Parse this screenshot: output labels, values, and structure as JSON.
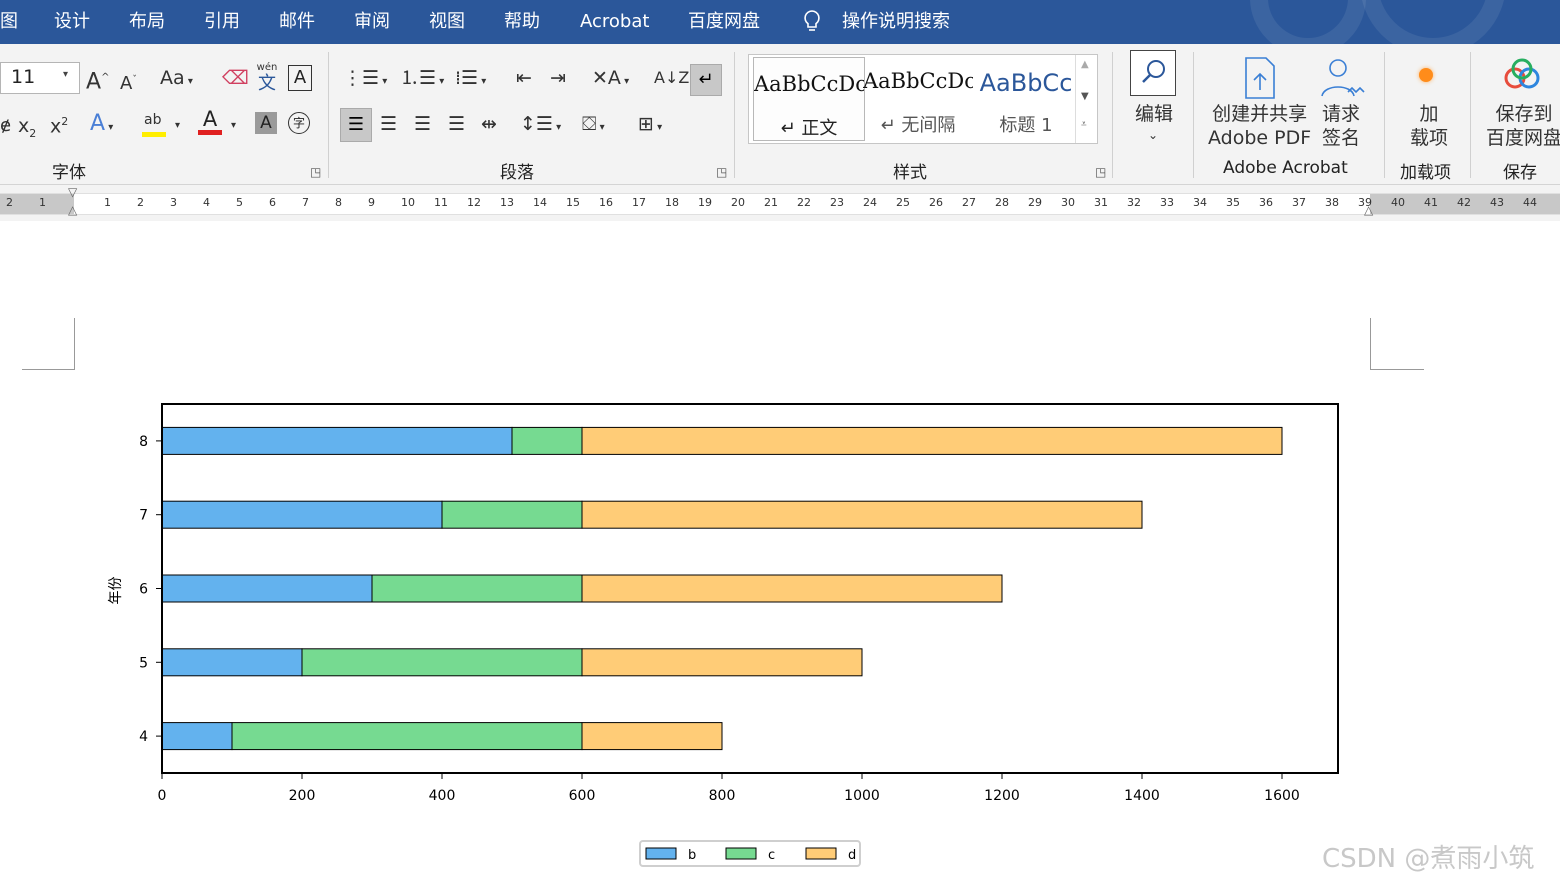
{
  "menu": {
    "items": [
      "图",
      "设计",
      "布局",
      "引用",
      "邮件",
      "审阅",
      "视图",
      "帮助",
      "Acrobat",
      "百度网盘"
    ],
    "search_label": "操作说明搜索"
  },
  "ribbon": {
    "font": {
      "size_value": "11",
      "aa_label": "Aa",
      "wen_label": "wén",
      "wen_char": "文",
      "group_label": "字体"
    },
    "paragraph": {
      "group_label": "段落"
    },
    "styles": {
      "items": [
        {
          "preview": "AaBbCcDc",
          "name": "↵ 正文"
        },
        {
          "preview": "AaBbCcDc",
          "name": "↵ 无间隔"
        },
        {
          "preview": "AaBbCc",
          "name": "标题 1"
        }
      ],
      "group_label": "样式"
    },
    "edit": {
      "label": "编辑"
    },
    "acrobat": {
      "create_line1": "创建并共享",
      "create_line2": "Adobe PDF",
      "sign_line1": "请求",
      "sign_line2": "签名",
      "group_label": "Adobe Acrobat"
    },
    "addins": {
      "line1": "加",
      "line2": "载项",
      "group_label": "加载项"
    },
    "baidu": {
      "line1": "保存到",
      "line2": "百度网盘",
      "group_label": "保存"
    }
  },
  "ruler": {
    "left_numbers": [
      "2",
      "1"
    ],
    "numbers": [
      "1",
      "2",
      "3",
      "4",
      "5",
      "6",
      "7",
      "8",
      "9",
      "10",
      "11",
      "12",
      "13",
      "14",
      "15",
      "16",
      "17",
      "18",
      "19",
      "20",
      "21",
      "22",
      "23",
      "24",
      "25",
      "26",
      "27",
      "28",
      "29",
      "30",
      "31",
      "32",
      "33",
      "34",
      "35",
      "36",
      "37",
      "38",
      "39",
      "40",
      "41",
      "42",
      "43",
      "44"
    ]
  },
  "chart_data": {
    "type": "bar",
    "orientation": "horizontal",
    "stacked": true,
    "categories": [
      "4",
      "5",
      "6",
      "7",
      "8"
    ],
    "series": [
      {
        "name": "b",
        "values": [
          100,
          200,
          300,
          400,
          500
        ],
        "color": "#63b2ee"
      },
      {
        "name": "c",
        "values": [
          500,
          400,
          300,
          200,
          100
        ],
        "color": "#76da91"
      },
      {
        "name": "d",
        "values": [
          200,
          400,
          600,
          800,
          1000
        ],
        "color": "#ffcc77"
      }
    ],
    "xlim": [
      0,
      1680
    ],
    "xticks": [
      0,
      200,
      400,
      600,
      800,
      1000,
      1200,
      1400,
      1600
    ],
    "ylabel": "年份",
    "xlabel": "",
    "title": "",
    "legend": "bottom-center",
    "grid": false
  },
  "watermark": "CSDN @煮雨小筑",
  "colors": {
    "menu_bg": "#2b579a",
    "ribbon_bg": "#f3f3f3"
  }
}
